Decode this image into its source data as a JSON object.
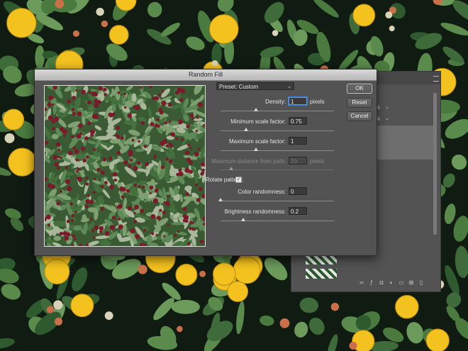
{
  "dialog": {
    "title": "Random Fill",
    "preset_label": "Preset: Custom",
    "buttons": {
      "ok": "OK",
      "reset": "Reset",
      "cancel": "Cancel"
    },
    "density": {
      "label": "Density:",
      "value": "1",
      "unit": "pixels"
    },
    "min_scale": {
      "label": "Minimum scale factor:",
      "value": "0.75"
    },
    "max_scale": {
      "label": "Maximum scale factor:",
      "value": "1"
    },
    "max_distance": {
      "label": "Maximum distance from path:",
      "value": "20",
      "unit": "pixels"
    },
    "rotate": {
      "label": "Rotate pattern:",
      "checked": true
    },
    "color_randomness": {
      "label": "Color randomness:",
      "value": "0"
    },
    "brightness_randomness": {
      "label": "Brightness randomness:",
      "value": "0.2"
    }
  },
  "layers_panel": {
    "opacity_pct": "%",
    "fill_pct": "%"
  },
  "colors": {
    "dialog_bg": "#535353",
    "focus": "#5b9be6",
    "leaf": "#3f6b3a",
    "fruit": "#f3c21f",
    "berry": "#7a1a2a"
  }
}
